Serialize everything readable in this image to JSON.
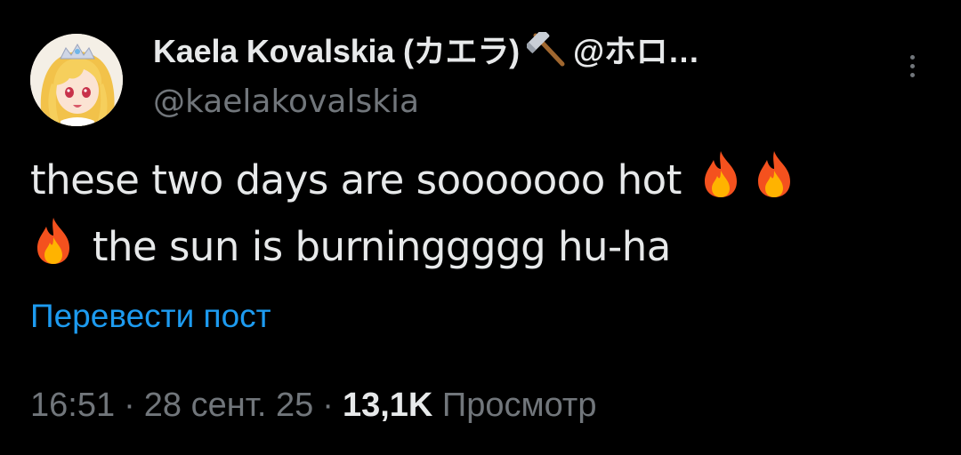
{
  "author": {
    "display_name": "Kaela Kovalskia (カエラ)",
    "display_name_suffix": "@ホロ…",
    "handle": "@kaelakovalskia",
    "avatar_icon": "anime-avatar-blonde-tiara",
    "name_emoji_icon": "hammer-icon"
  },
  "tweet": {
    "text_part1": "these two days are sooooooo hot",
    "text_part2": "the sun is burninggggg hu-ha",
    "emoji_icon": "fire-icon",
    "translate_label": "Перевести пост"
  },
  "meta": {
    "time": "16:51",
    "date": "28 сент. 25",
    "separator": "·",
    "views_count": "13,1K",
    "views_label": "Просмотр"
  },
  "colors": {
    "background": "#000000",
    "text_primary": "#e7e9ea",
    "text_secondary": "#71767b",
    "link": "#1d9bf0"
  }
}
